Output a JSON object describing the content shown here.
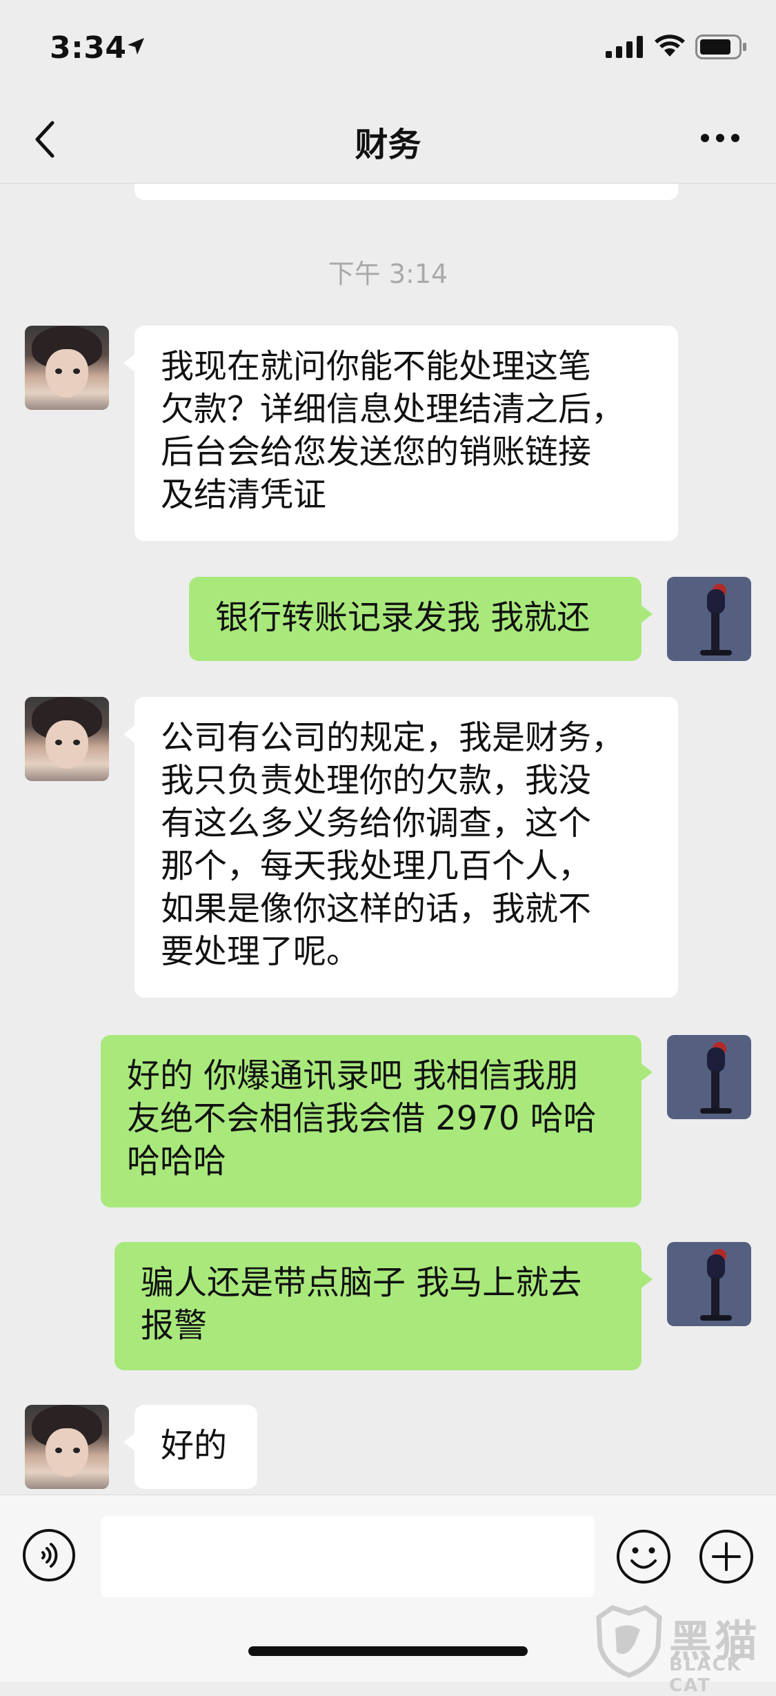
{
  "status_bar": {
    "time": "3:34"
  },
  "nav": {
    "title": "财务"
  },
  "chat": {
    "timestamp": "下午 3:14",
    "messages": [
      {
        "side": "in",
        "text": "我现在就问你能不能处理这笔\n欠款？详细信息处理结清之后，\n后台会给您发送您的销账链接\n及结清凭证"
      },
      {
        "side": "out",
        "text": "银行转账记录发我 我就还"
      },
      {
        "side": "in",
        "text": "公司有公司的规定，我是财务，\n我只负责处理你的欠款，我没\n有这么多义务给你调查，这个\n那个，每天我处理几百个人，\n如果是像你这样的话，我就不\n要处理了呢。"
      },
      {
        "side": "out",
        "text": "好的 你爆通讯录吧 我相信我朋\n友绝不会相信我会借 2970 哈哈\n哈哈哈"
      },
      {
        "side": "out",
        "text": "骗人还是带点脑子 我马上就去\n报警"
      },
      {
        "side": "in",
        "text": "好的"
      }
    ]
  },
  "input_bar": {
    "placeholder": ""
  },
  "watermark": {
    "cn": "黑猫",
    "en": "BLACK CAT"
  },
  "colors": {
    "background": "#ededed",
    "incoming": "#ffffff",
    "outgoing": "#a9e97c",
    "timestamp": "#a9a9a9"
  },
  "icons": [
    "location-arrow-icon",
    "signal-icon",
    "wifi-icon",
    "battery-icon",
    "back-chevron-icon",
    "more-dots-icon",
    "voice-icon",
    "emoji-icon",
    "plus-icon"
  ]
}
